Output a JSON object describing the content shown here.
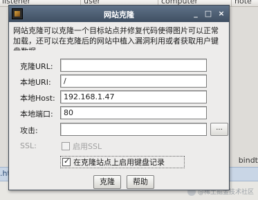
{
  "background": {
    "columns": [
      "listener",
      "user",
      "computer",
      "note"
    ],
    "strip_left": ".http",
    "strip_right": "bindt",
    "watermark": "@稀土掘金技术社区"
  },
  "dialog": {
    "title": "网站克隆",
    "controls": {
      "minimize": "_",
      "maximize": "□",
      "close": "×"
    },
    "description": "网站克隆可以克隆一个目标站点并修复代码使得图片可以正常加载，还可以在克隆后的网站中植入漏洞利用或者获取用户键盘数据。",
    "fields": {
      "clone_url": {
        "label": "克隆URL:",
        "value": ""
      },
      "local_uri": {
        "label": "本地URI:",
        "value": "/"
      },
      "local_host": {
        "label": "本地Host:",
        "value": "192.168.1.47"
      },
      "local_port": {
        "label": "本地端口:",
        "value": "80"
      },
      "attack": {
        "label": "攻击:",
        "value": "",
        "browse_label": "..."
      }
    },
    "ssl": {
      "label": "SSL:",
      "checkbox_label": "启用SSL",
      "checked": false,
      "enabled": false
    },
    "keylogger": {
      "checkbox_label": "在克隆站点上启用键盘记录",
      "checked": true
    },
    "buttons": {
      "clone": "克隆",
      "help": "帮助"
    }
  }
}
